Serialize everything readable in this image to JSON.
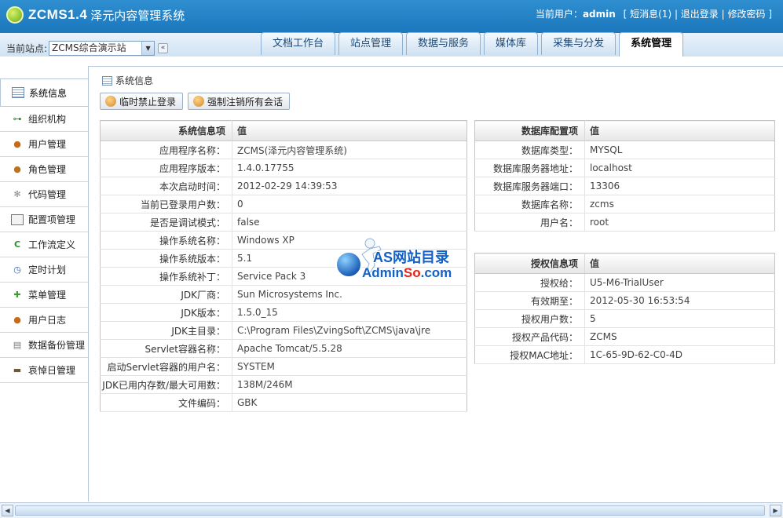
{
  "header": {
    "logo_text": "ZCMS1.4",
    "logo_sub": "泽元内容管理系统",
    "user_label": "当前用户：",
    "user_name": "admin",
    "links": [
      "[ 短消息(1)",
      "| 退出登录",
      "| 修改密码 ]"
    ]
  },
  "site": {
    "label": "当前站点:",
    "value": "ZCMS综合演示站"
  },
  "tabs": [
    "文档工作台",
    "站点管理",
    "数据与服务",
    "媒体库",
    "采集与分发",
    "系统管理"
  ],
  "sidebar": {
    "items": [
      {
        "label": "系统信息",
        "icon": "list-icon"
      },
      {
        "label": "组织机构",
        "icon": "org-icon"
      },
      {
        "label": "用户管理",
        "icon": "user-icon"
      },
      {
        "label": "角色管理",
        "icon": "role-icon"
      },
      {
        "label": "代码管理",
        "icon": "gear-icon"
      },
      {
        "label": "配置项管理",
        "icon": "config-icon"
      },
      {
        "label": "工作流定义",
        "icon": "workflow-icon"
      },
      {
        "label": "定时计划",
        "icon": "clock-icon"
      },
      {
        "label": "菜单管理",
        "icon": "puzzle-icon"
      },
      {
        "label": "用户日志",
        "icon": "user-log-icon"
      },
      {
        "label": "数据备份管理",
        "icon": "database-icon"
      },
      {
        "label": "哀悼日管理",
        "icon": "truck-icon"
      }
    ]
  },
  "panel": {
    "title": "系统信息",
    "buttons": [
      "临时禁止登录",
      "强制注销所有会话"
    ]
  },
  "sysinfo": {
    "headers": [
      "系统信息项",
      "值"
    ],
    "rows": [
      [
        "应用程序名称：",
        "ZCMS(泽元内容管理系统)"
      ],
      [
        "应用程序版本：",
        "1.4.0.17755"
      ],
      [
        "本次启动时间：",
        "2012-02-29 14:39:53"
      ],
      [
        "当前已登录用户数：",
        "0"
      ],
      [
        "是否是调试模式：",
        "false"
      ],
      [
        "操作系统名称：",
        "Windows XP"
      ],
      [
        "操作系统版本：",
        "5.1"
      ],
      [
        "操作系统补丁：",
        "Service Pack 3"
      ],
      [
        "JDK厂商：",
        "Sun Microsystems Inc."
      ],
      [
        "JDK版本：",
        "1.5.0_15"
      ],
      [
        "JDK主目录：",
        "C:\\Program Files\\ZvingSoft\\ZCMS\\java\\jre"
      ],
      [
        "Servlet容器名称：",
        "Apache Tomcat/5.5.28"
      ],
      [
        "启动Servlet容器的用户名：",
        "SYSTEM"
      ],
      [
        "JDK已用内存数/最大可用数：",
        "138M/246M"
      ],
      [
        "文件编码：",
        "GBK"
      ]
    ]
  },
  "dbinfo": {
    "headers": [
      "数据库配置项",
      "值"
    ],
    "rows": [
      [
        "数据库类型：",
        "MYSQL"
      ],
      [
        "数据库服务器地址：",
        "localhost"
      ],
      [
        "数据库服务器端口：",
        "13306"
      ],
      [
        "数据库名称：",
        "zcms"
      ],
      [
        "用户名：",
        "root"
      ]
    ]
  },
  "license": {
    "headers": [
      "授权信息项",
      "值"
    ],
    "rows": [
      [
        "授权给：",
        "U5-M6-TrialUser"
      ],
      [
        "有效期至：",
        "2012-05-30 16:53:54"
      ],
      [
        "授权用户数：",
        "5"
      ],
      [
        "授权产品代码：",
        "ZCMS"
      ],
      [
        "授权MAC地址：",
        "1C-65-9D-62-C0-4D"
      ]
    ]
  },
  "watermark": {
    "line1": "AS网站目录",
    "line2a": "Admin",
    "line2b": "So",
    "line2c": ".com"
  }
}
